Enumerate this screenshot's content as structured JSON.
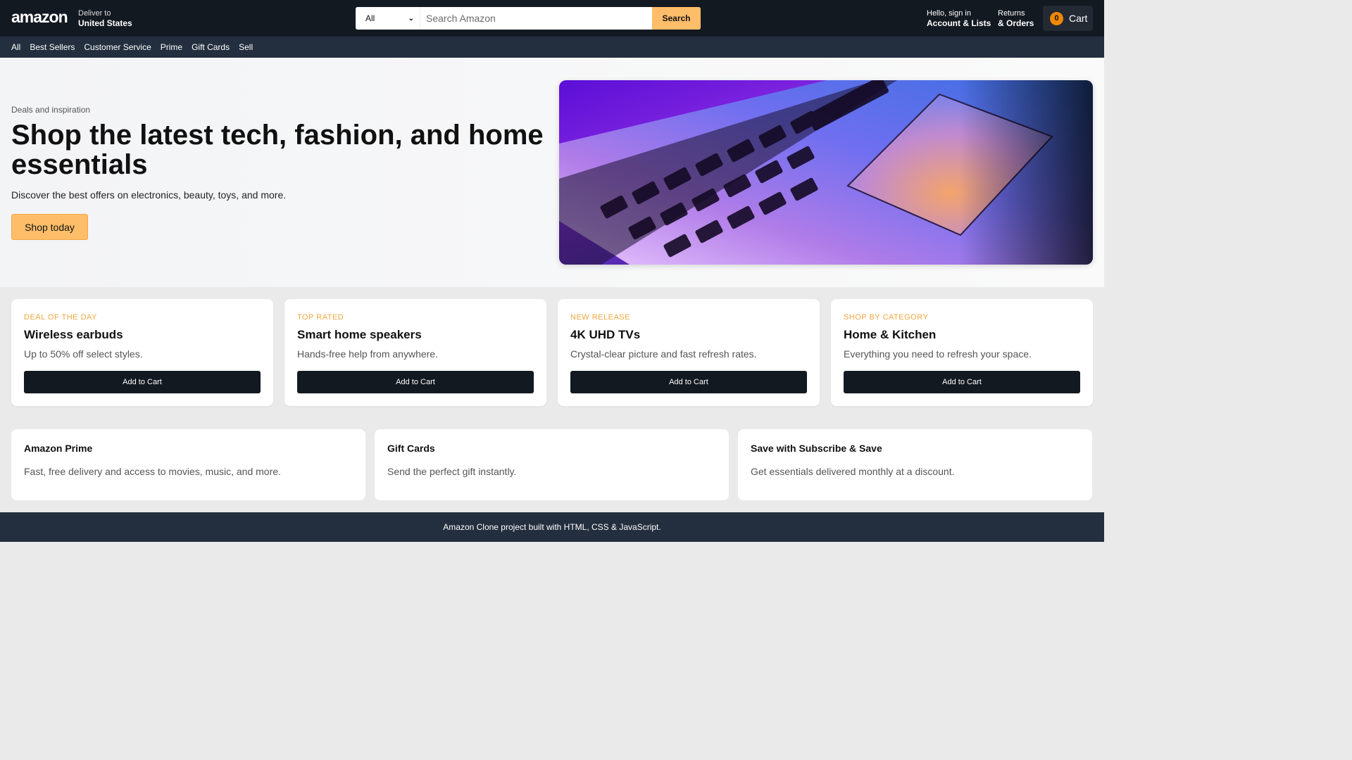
{
  "header": {
    "logo": "amazon",
    "deliver_label": "Deliver to",
    "deliver_location": "United States",
    "search_category": "All",
    "search_placeholder": "Search Amazon",
    "search_button": "Search",
    "account_greeting": "Hello, sign in",
    "account_label": "Account & Lists",
    "returns_label": "Returns",
    "orders_label": "& Orders",
    "cart_count": "0",
    "cart_label": "Cart"
  },
  "nav": {
    "items": [
      "All",
      "Best Sellers",
      "Customer Service",
      "Prime",
      "Gift Cards",
      "Sell"
    ]
  },
  "hero": {
    "kicker": "Deals and inspiration",
    "title": "Shop the latest tech, fashion, and home essentials",
    "description": "Discover the best offers on electronics, beauty, toys, and more.",
    "button": "Shop today"
  },
  "deals": [
    {
      "kicker": "DEAL OF THE DAY",
      "title": "Wireless earbuds",
      "description": "Up to 50% off select styles.",
      "button": "Add to Cart"
    },
    {
      "kicker": "TOP RATED",
      "title": "Smart home speakers",
      "description": "Hands-free help from anywhere.",
      "button": "Add to Cart"
    },
    {
      "kicker": "NEW RELEASE",
      "title": "4K UHD TVs",
      "description": "Crystal-clear picture and fast refresh rates.",
      "button": "Add to Cart"
    },
    {
      "kicker": "SHOP BY CATEGORY",
      "title": "Home & Kitchen",
      "description": "Everything you need to refresh your space.",
      "button": "Add to Cart"
    }
  ],
  "info": [
    {
      "title": "Amazon Prime",
      "description": "Fast, free delivery and access to movies, music, and more."
    },
    {
      "title": "Gift Cards",
      "description": "Send the perfect gift instantly."
    },
    {
      "title": "Save with Subscribe & Save",
      "description": "Get essentials delivered monthly at a discount."
    }
  ],
  "footer": {
    "text": "Amazon Clone project built with HTML, CSS & JavaScript."
  },
  "colors": {
    "header_bg": "#131921",
    "nav_bg": "#232f3e",
    "accent": "#febd69",
    "kicker": "#f0a641",
    "cart_badge": "#f08804"
  }
}
